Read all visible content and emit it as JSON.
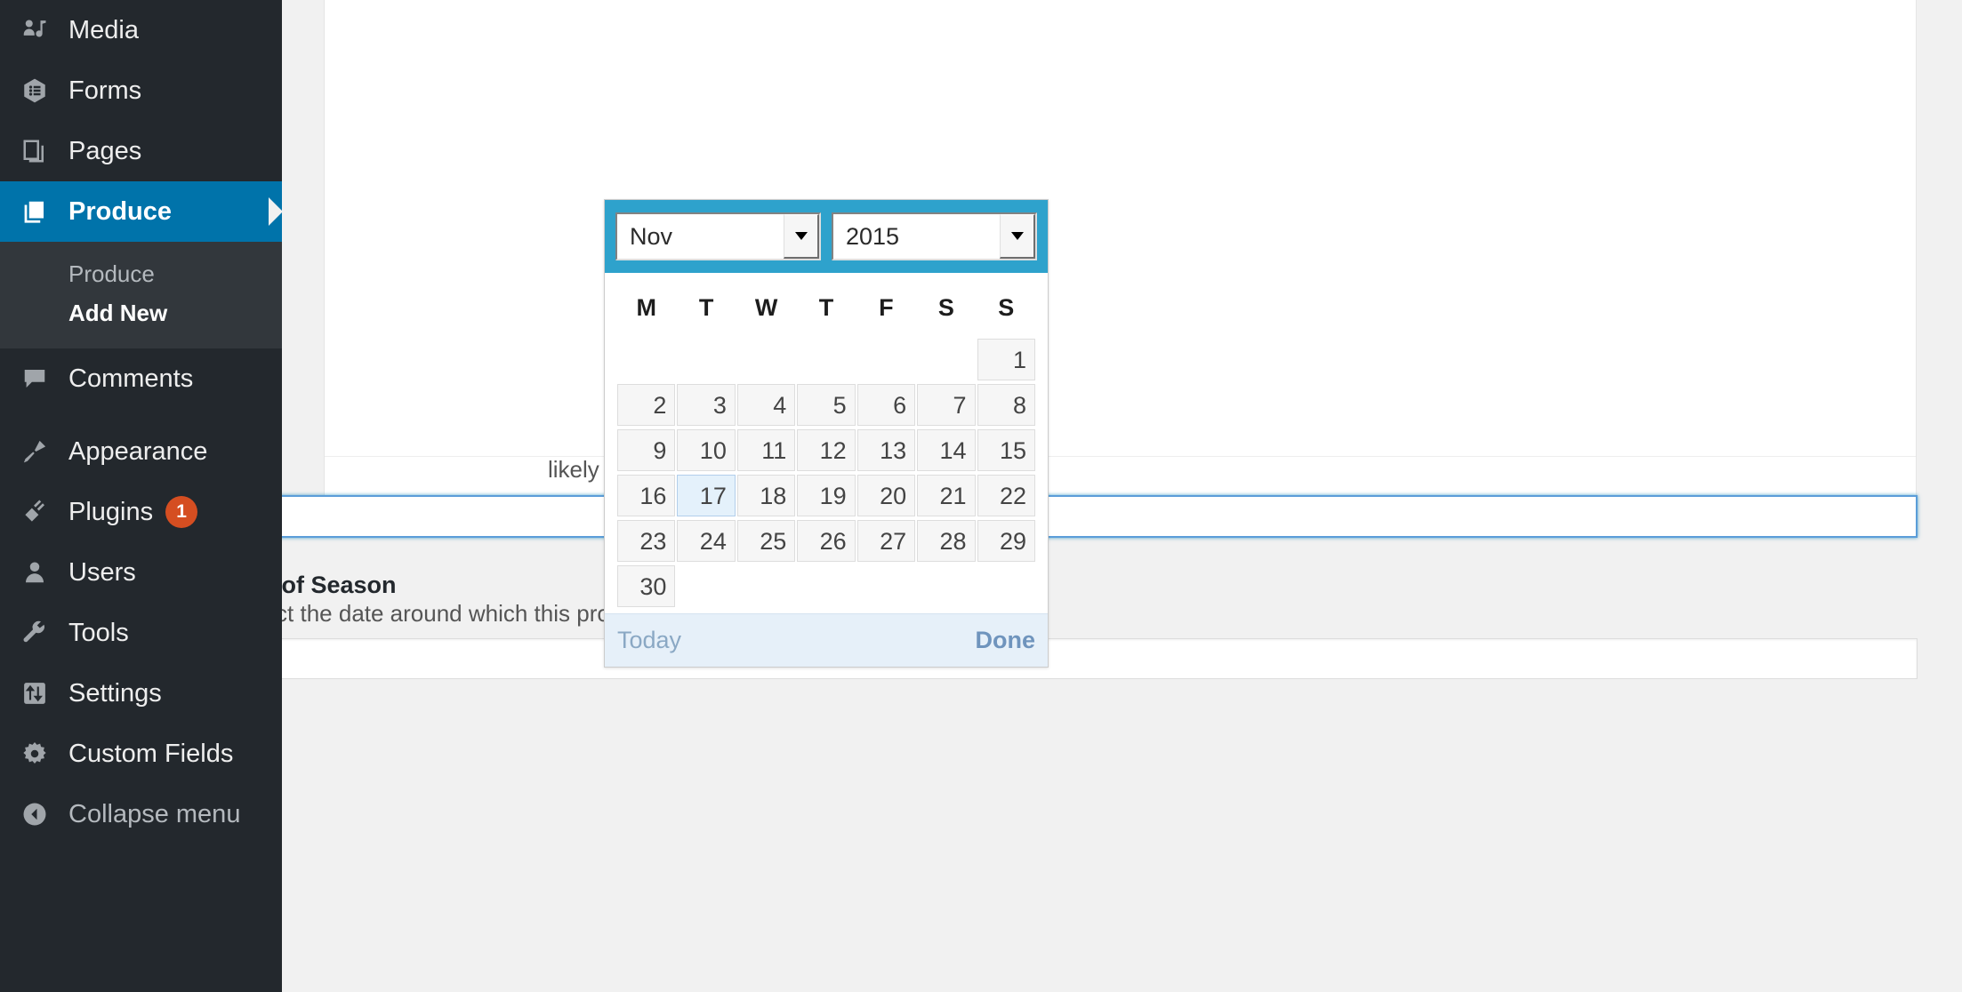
{
  "sidebar": {
    "items": [
      {
        "label": "Media",
        "icon": "media-icon",
        "state": "normal"
      },
      {
        "label": "Forms",
        "icon": "forms-icon",
        "state": "normal"
      },
      {
        "label": "Pages",
        "icon": "pages-icon",
        "state": "normal"
      },
      {
        "label": "Produce",
        "icon": "produce-icon",
        "state": "current"
      },
      {
        "label": "Comments",
        "icon": "comments-icon",
        "state": "normal"
      },
      {
        "label": "Appearance",
        "icon": "appearance-icon",
        "state": "normal"
      },
      {
        "label": "Plugins",
        "icon": "plugins-icon",
        "state": "normal",
        "badge": "1"
      },
      {
        "label": "Users",
        "icon": "users-icon",
        "state": "normal"
      },
      {
        "label": "Tools",
        "icon": "tools-icon",
        "state": "normal"
      },
      {
        "label": "Settings",
        "icon": "settings-icon",
        "state": "normal"
      },
      {
        "label": "Custom Fields",
        "icon": "gear-icon",
        "state": "normal"
      },
      {
        "label": "Collapse menu",
        "icon": "collapse-icon",
        "state": "collapse"
      }
    ],
    "submenu": {
      "items": [
        {
          "label": "Produce",
          "active": false
        },
        {
          "label": "Add New",
          "active": true
        }
      ]
    },
    "colors": {
      "background": "#23282d",
      "submenu_background": "#32373c",
      "current_highlight": "#0073aa",
      "badge": "#d54e21"
    }
  },
  "start_of_season": {
    "help_text_visible_fragment": "likely to become available.",
    "input_value": "",
    "input_placeholder": ""
  },
  "end_of_season": {
    "label": "End of Season",
    "help_text": "Select the date around which this produce is likely to be out of season.",
    "input_value": "",
    "input_placeholder": ""
  },
  "datepicker": {
    "month": "Nov",
    "year": "2015",
    "month_caret_icon": "chevron-down-icon",
    "year_caret_icon": "chevron-down-icon",
    "weekday_headers": [
      "M",
      "T",
      "W",
      "T",
      "F",
      "S",
      "S"
    ],
    "weeks": [
      [
        "",
        "",
        "",
        "",
        "",
        "",
        "1"
      ],
      [
        "2",
        "3",
        "4",
        "5",
        "6",
        "7",
        "8"
      ],
      [
        "9",
        "10",
        "11",
        "12",
        "13",
        "14",
        "15"
      ],
      [
        "16",
        "17",
        "18",
        "19",
        "20",
        "21",
        "22"
      ],
      [
        "23",
        "24",
        "25",
        "26",
        "27",
        "28",
        "29"
      ],
      [
        "30",
        "",
        "",
        "",
        "",
        "",
        ""
      ]
    ],
    "highlighted_day": "17",
    "today_label": "Today",
    "done_label": "Done",
    "colors": {
      "header": "#2ea2cc",
      "footer": "#e6f0f9",
      "highlight_cell": "#e4f1fb",
      "highlight_border": "#b2ceeb"
    }
  }
}
